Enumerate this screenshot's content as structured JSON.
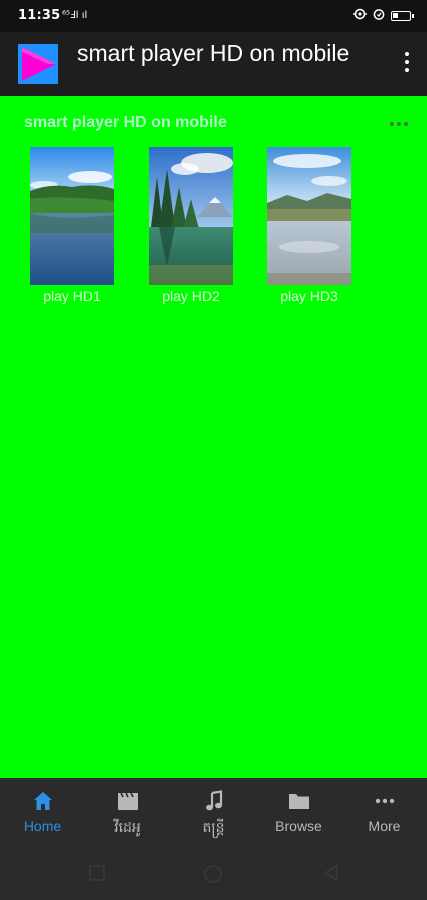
{
  "status_bar": {
    "time": "11:35",
    "left_icons": "ʿ𝓈ₘ ⇗ 𝓁ᵏⁿ",
    "icons": [
      "location-icon",
      "alarm-icon",
      "battery-icon"
    ]
  },
  "app_bar": {
    "title": "smart player HD on mobile",
    "menu_icon": "more-vertical-icon"
  },
  "section": {
    "title": "smart player HD on mobile",
    "more_icon": "more-horizontal-icon"
  },
  "videos": [
    {
      "label": "play HD1",
      "thumb": "lake-forest-thumbnail"
    },
    {
      "label": "play HD2",
      "thumb": "mountain-pine-lake-thumbnail"
    },
    {
      "label": "play HD3",
      "thumb": "calm-lake-sky-thumbnail"
    }
  ],
  "bottom_nav": {
    "items": [
      {
        "label": "Home",
        "icon": "home-icon",
        "active": true
      },
      {
        "label": "វីដេអូ",
        "icon": "clapperboard-icon",
        "active": false
      },
      {
        "label": "តន្ត្រី",
        "icon": "music-note-icon",
        "active": false
      },
      {
        "label": "Browse",
        "icon": "folder-icon",
        "active": false
      },
      {
        "label": "More",
        "icon": "more-horizontal-icon",
        "active": false
      }
    ],
    "active_color": "#2d8fe6",
    "inactive_color": "#b8b8b8"
  },
  "colors": {
    "background": "#00ff00",
    "app_bar": "#1e1e1e",
    "bottom_nav": "#2b2b2b"
  }
}
